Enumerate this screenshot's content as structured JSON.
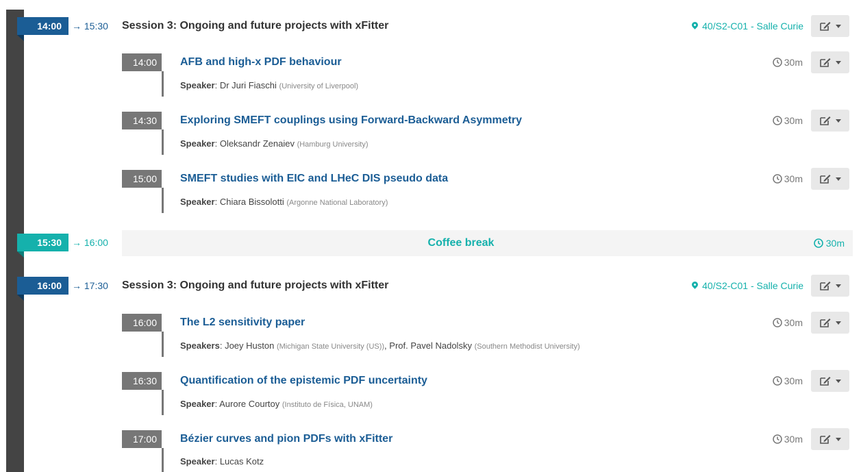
{
  "colors": {
    "session": "#1b5d95",
    "break": "#15b1ac",
    "contribution": "#777777"
  },
  "session1": {
    "start": "14:00",
    "end": "→ 15:30",
    "title": "Session 3: Ongoing and future projects with xFitter",
    "location": "40/S2-C01 - Salle Curie",
    "contributions": [
      {
        "time": "14:00",
        "title": "AFB and high-x PDF behaviour",
        "speaker_label": "Speaker",
        "speaker": "Dr Juri Fiaschi",
        "affiliation": "(University of Liverpool)",
        "duration": "30m"
      },
      {
        "time": "14:30",
        "title": "Exploring SMEFT couplings using Forward-Backward Asymmetry",
        "speaker_label": "Speaker",
        "speaker": "Oleksandr Zenaiev",
        "affiliation": "(Hamburg University)",
        "duration": "30m"
      },
      {
        "time": "15:00",
        "title": "SMEFT studies with EIC and LHeC DIS pseudo data",
        "speaker_label": "Speaker",
        "speaker": "Chiara Bissolotti",
        "affiliation": "(Argonne National Laboratory)",
        "duration": "30m"
      }
    ]
  },
  "coffee": {
    "start": "15:30",
    "end": "→ 16:00",
    "title": "Coffee break",
    "duration": "30m"
  },
  "session2": {
    "start": "16:00",
    "end": "→ 17:30",
    "title": "Session 3: Ongoing and future projects with xFitter",
    "location": "40/S2-C01 - Salle Curie",
    "contributions": [
      {
        "time": "16:00",
        "title": "The L2 sensitivity paper",
        "speaker_label": "Speakers",
        "speaker": "Joey Huston",
        "affiliation": "(Michigan State University (US))",
        "speaker2": "Prof. Pavel Nadolsky",
        "affiliation2": "(Southern Methodist University)",
        "duration": "30m"
      },
      {
        "time": "16:30",
        "title": "Quantification of the epistemic PDF uncertainty",
        "speaker_label": "Speaker",
        "speaker": "Aurore Courtoy",
        "affiliation": "(Instituto de Física, UNAM)",
        "duration": "30m"
      },
      {
        "time": "17:00",
        "title": "Bézier curves and pion PDFs with xFitter",
        "speaker_label": "Speaker",
        "speaker": "Lucas Kotz",
        "duration": "30m"
      }
    ]
  }
}
